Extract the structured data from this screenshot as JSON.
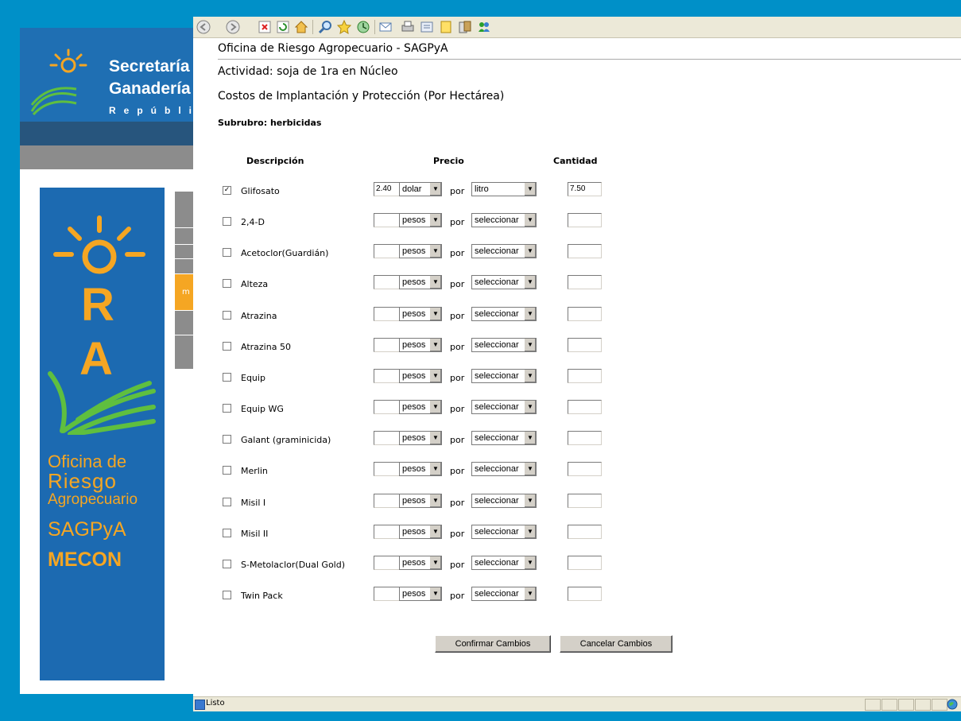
{
  "background_site": {
    "header_line1": "Secretaría",
    "header_line2": "Ganadería",
    "header_line3": "República",
    "banner_r": "R",
    "banner_a": "A",
    "banner_line1": "Oficina de",
    "banner_line2": "Riesgo",
    "banner_line3": "Agropecuario",
    "banner_line4": "SAGPyA",
    "banner_line5": "MECON",
    "menu_fragment": "m"
  },
  "colors": {
    "page_bg": "#0090c8",
    "brand_blue": "#1c6ab1",
    "brand_orange": "#f5a623"
  },
  "toolbar": {
    "icons": [
      "back-icon",
      "forward-icon",
      "stop-icon",
      "refresh-icon",
      "home-icon",
      "search-icon",
      "favorites-icon",
      "history-icon",
      "mail-icon",
      "print-icon",
      "edit-icon",
      "notes-icon",
      "research-icon",
      "messenger-icon"
    ]
  },
  "page": {
    "title": "Oficina de Riesgo Agropecuario - SAGPyA",
    "activity": "Actividad: soja de 1ra en Núcleo",
    "section": "Costos de Implantación y Protección (Por Hectárea)",
    "subrubro": "Subrubro: herbicidas"
  },
  "table": {
    "headers": {
      "descripcion": "Descripción",
      "precio": "Precio",
      "cantidad": "Cantidad"
    },
    "por_label": "por",
    "rows": [
      {
        "checked": true,
        "name": "Glifosato",
        "price": "2.40",
        "currency": "dolar",
        "unit": "litro",
        "qty": "7.50"
      },
      {
        "checked": false,
        "name": "2,4-D",
        "price": "",
        "currency": "pesos",
        "unit": "seleccionar",
        "qty": ""
      },
      {
        "checked": false,
        "name": "Acetoclor(Guardián)",
        "price": "",
        "currency": "pesos",
        "unit": "seleccionar",
        "qty": ""
      },
      {
        "checked": false,
        "name": "Alteza",
        "price": "",
        "currency": "pesos",
        "unit": "seleccionar",
        "qty": ""
      },
      {
        "checked": false,
        "name": "Atrazina",
        "price": "",
        "currency": "pesos",
        "unit": "seleccionar",
        "qty": ""
      },
      {
        "checked": false,
        "name": "Atrazina 50",
        "price": "",
        "currency": "pesos",
        "unit": "seleccionar",
        "qty": ""
      },
      {
        "checked": false,
        "name": "Equip",
        "price": "",
        "currency": "pesos",
        "unit": "seleccionar",
        "qty": ""
      },
      {
        "checked": false,
        "name": "Equip WG",
        "price": "",
        "currency": "pesos",
        "unit": "seleccionar",
        "qty": ""
      },
      {
        "checked": false,
        "name": "Galant (graminicida)",
        "price": "",
        "currency": "pesos",
        "unit": "seleccionar",
        "qty": ""
      },
      {
        "checked": false,
        "name": "Merlin",
        "price": "",
        "currency": "pesos",
        "unit": "seleccionar",
        "qty": ""
      },
      {
        "checked": false,
        "name": "Misil I",
        "price": "",
        "currency": "pesos",
        "unit": "seleccionar",
        "qty": ""
      },
      {
        "checked": false,
        "name": "Misil II",
        "price": "",
        "currency": "pesos",
        "unit": "seleccionar",
        "qty": ""
      },
      {
        "checked": false,
        "name": "S-Metolaclor(Dual Gold)",
        "price": "",
        "currency": "pesos",
        "unit": "seleccionar",
        "qty": ""
      },
      {
        "checked": false,
        "name": "Twin Pack",
        "price": "",
        "currency": "pesos",
        "unit": "seleccionar",
        "qty": ""
      }
    ]
  },
  "buttons": {
    "confirm": "Confirmar Cambios",
    "cancel": "Cancelar Cambios"
  },
  "status": {
    "text": "Listo"
  }
}
